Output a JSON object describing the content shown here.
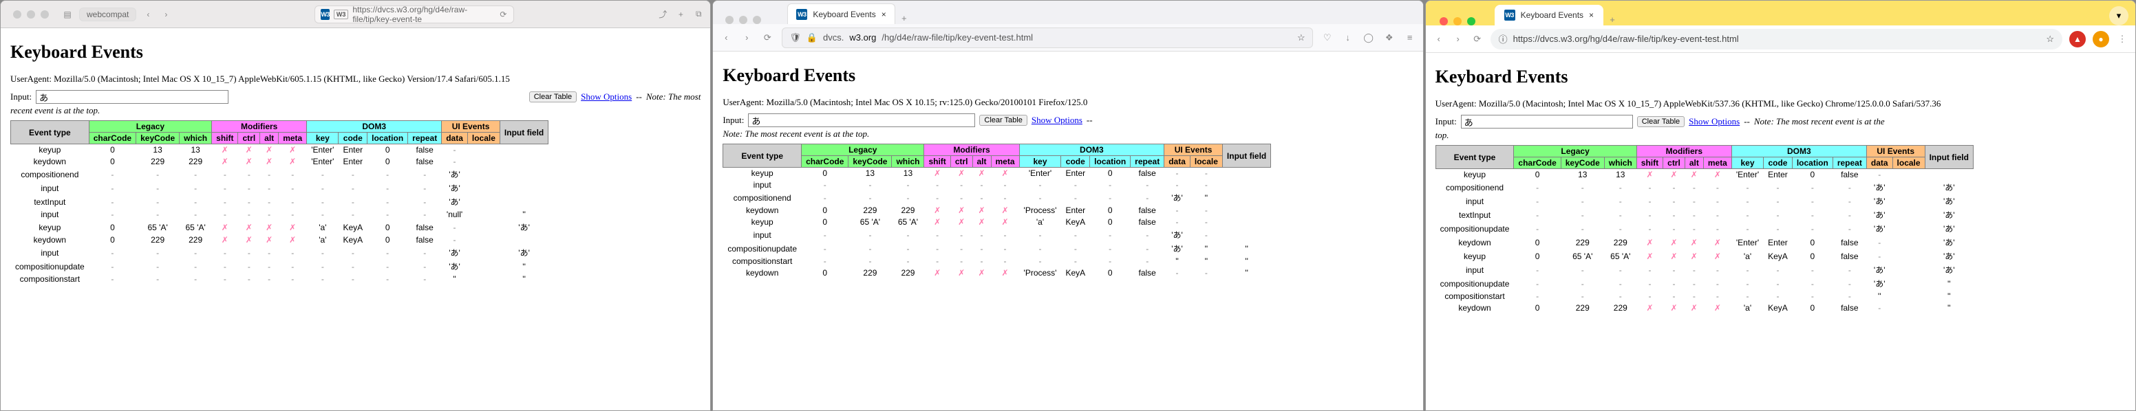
{
  "page": {
    "title": "Keyboard Events",
    "input_label": "Input:",
    "input_value": "あ",
    "clear_btn": "Clear Table",
    "show_options": "Show Options",
    "note_sep": " -- ",
    "note": "Note: The most recent event is at the top.",
    "headers": {
      "event_type": "Event type",
      "legacy": "Legacy",
      "modifiers": "Modifiers",
      "dom3": "DOM3",
      "ui": "UI Events",
      "inputf": "Input field",
      "charCode": "charCode",
      "keyCode": "keyCode",
      "which": "which",
      "shift": "shift",
      "ctrl": "ctrl",
      "alt": "alt",
      "meta": "meta",
      "key": "key",
      "code": "code",
      "location": "location",
      "repeat": "repeat",
      "data": "data",
      "locale": "locale"
    }
  },
  "label": {
    "w3": "W3",
    "close_x": "×",
    "plus": "+",
    "back": "‹",
    "fwd": "›",
    "reload": "⟳",
    "share": "⤴",
    "tabs": "⧉",
    "shield": "🛡",
    "lock": "🔒",
    "star": "☆",
    "download": "↓",
    "ext": "❖",
    "menu": "≡",
    "dots": "⋮",
    "sidebar": "▤",
    "heart": "♡"
  },
  "w1": {
    "tab_inactive": "webcompat",
    "url": "https://dvcs.w3.org/hg/d4e/raw-file/tip/key-event-te",
    "ua": "UserAgent: Mozilla/5.0 (Macintosh; Intel Mac OS X 10_15_7) AppleWebKit/605.1.15 (KHTML, like Gecko) Version/17.4 Safari/605.1.15",
    "rows": [
      {
        "t": "keyup",
        "cc": "0",
        "kc": "13",
        "wh": "13",
        "key": "'Enter'",
        "code": "Enter",
        "loc": "0",
        "rep": "false",
        "data": "-",
        "loc2": "",
        "inp": ""
      },
      {
        "t": "keydown",
        "cc": "0",
        "kc": "229",
        "wh": "229",
        "key": "'Enter'",
        "code": "Enter",
        "loc": "0",
        "rep": "false",
        "data": "-",
        "loc2": "",
        "inp": ""
      },
      {
        "t": "compositionend",
        "cc": "-",
        "kc": "-",
        "wh": "-",
        "mods": "-",
        "key": "-",
        "code": "-",
        "loc": "-",
        "rep": "-",
        "data": "'あ'",
        "loc2": "",
        "inp": ""
      },
      {
        "t": "input",
        "cc": "-",
        "kc": "-",
        "wh": "-",
        "mods": "-",
        "key": "-",
        "code": "-",
        "loc": "-",
        "rep": "-",
        "data": "'あ'",
        "loc2": "",
        "inp": ""
      },
      {
        "t": "textInput",
        "cc": "-",
        "kc": "-",
        "wh": "-",
        "mods": "-",
        "key": "-",
        "code": "-",
        "loc": "-",
        "rep": "-",
        "data": "'あ'",
        "loc2": "",
        "inp": ""
      },
      {
        "t": "input",
        "cc": "-",
        "kc": "-",
        "wh": "-",
        "mods": "-",
        "key": "-",
        "code": "-",
        "loc": "-",
        "rep": "-",
        "data": "'null'",
        "loc2": "",
        "inp": "''"
      },
      {
        "t": "keyup",
        "cc": "0",
        "kc": "65 'A'",
        "wh": "65 'A'",
        "key": "'a'",
        "code": "KeyA",
        "loc": "0",
        "rep": "false",
        "data": "-",
        "loc2": "",
        "inp": "'あ'"
      },
      {
        "t": "keydown",
        "cc": "0",
        "kc": "229",
        "wh": "229",
        "key": "'a'",
        "code": "KeyA",
        "loc": "0",
        "rep": "false",
        "data": "-",
        "loc2": "",
        "inp": ""
      },
      {
        "t": "input",
        "cc": "-",
        "kc": "-",
        "wh": "-",
        "mods": "-",
        "key": "-",
        "code": "-",
        "loc": "-",
        "rep": "-",
        "data": "'あ'",
        "loc2": "",
        "inp": "'あ'"
      },
      {
        "t": "compositionupdate",
        "cc": "-",
        "kc": "-",
        "wh": "-",
        "mods": "-",
        "key": "-",
        "code": "-",
        "loc": "-",
        "rep": "-",
        "data": "'あ'",
        "loc2": "",
        "inp": "''"
      },
      {
        "t": "compositionstart",
        "cc": "-",
        "kc": "-",
        "wh": "-",
        "mods": "-",
        "key": "-",
        "code": "-",
        "loc": "-",
        "rep": "-",
        "data": "''",
        "loc2": "",
        "inp": "''"
      }
    ]
  },
  "w2": {
    "tab_title": "Keyboard Events",
    "url_pre": "dvcs.",
    "url_dom": "w3.org",
    "url_post": "/hg/d4e/raw-file/tip/key-event-test.html",
    "ua": "UserAgent: Mozilla/5.0 (Macintosh; Intel Mac OS X 10.15; rv:125.0) Gecko/20100101 Firefox/125.0",
    "rows": [
      {
        "t": "keyup",
        "cc": "0",
        "kc": "13",
        "wh": "13",
        "key": "'Enter'",
        "code": "Enter",
        "loc": "0",
        "rep": "false",
        "data": "-",
        "loc2": "-",
        "inp": ""
      },
      {
        "t": "input",
        "cc": "-",
        "kc": "-",
        "wh": "-",
        "mods": "-",
        "key": "-",
        "code": "-",
        "loc": "-",
        "rep": "-",
        "data": "-",
        "loc2": "-",
        "inp": ""
      },
      {
        "t": "compositionend",
        "cc": "-",
        "kc": "-",
        "wh": "-",
        "mods": "-",
        "key": "-",
        "code": "-",
        "loc": "-",
        "rep": "-",
        "data": "'あ'",
        "loc2": "''",
        "inp": ""
      },
      {
        "t": "keydown",
        "cc": "0",
        "kc": "229",
        "wh": "229",
        "key": "'Process'",
        "code": "Enter",
        "loc": "0",
        "rep": "false",
        "data": "-",
        "loc2": "-",
        "inp": ""
      },
      {
        "t": "keyup",
        "cc": "0",
        "kc": "65 'A'",
        "wh": "65 'A'",
        "key": "'a'",
        "code": "KeyA",
        "loc": "0",
        "rep": "false",
        "data": "-",
        "loc2": "-",
        "inp": ""
      },
      {
        "t": "input",
        "cc": "-",
        "kc": "-",
        "wh": "-",
        "mods": "-",
        "key": "-",
        "code": "-",
        "loc": "-",
        "rep": "-",
        "data": "'あ'",
        "loc2": "-",
        "inp": ""
      },
      {
        "t": "compositionupdate",
        "cc": "-",
        "kc": "-",
        "wh": "-",
        "mods": "-",
        "key": "-",
        "code": "-",
        "loc": "-",
        "rep": "-",
        "data": "'あ'",
        "loc2": "''",
        "inp": "''"
      },
      {
        "t": "compositionstart",
        "cc": "-",
        "kc": "-",
        "wh": "-",
        "mods": "-",
        "key": "-",
        "code": "-",
        "loc": "-",
        "rep": "-",
        "data": "''",
        "loc2": "''",
        "inp": "''"
      },
      {
        "t": "keydown",
        "cc": "0",
        "kc": "229",
        "wh": "229",
        "key": "'Process'",
        "code": "KeyA",
        "loc": "0",
        "rep": "false",
        "data": "-",
        "loc2": "-",
        "inp": "''"
      }
    ]
  },
  "w3": {
    "tab_title": "Keyboard Events",
    "url": "https://dvcs.w3.org/hg/d4e/raw-file/tip/key-event-test.html",
    "ua": "UserAgent: Mozilla/5.0 (Macintosh; Intel Mac OS X 10_15_7) AppleWebKit/537.36 (KHTML, like Gecko) Chrome/125.0.0.0 Safari/537.36",
    "rows": [
      {
        "t": "keyup",
        "cc": "0",
        "kc": "13",
        "wh": "13",
        "key": "'Enter'",
        "code": "Enter",
        "loc": "0",
        "rep": "false",
        "data": "-",
        "loc2": "",
        "inp": ""
      },
      {
        "t": "compositionend",
        "cc": "-",
        "kc": "-",
        "wh": "-",
        "mods": "-",
        "key": "-",
        "code": "-",
        "loc": "-",
        "rep": "-",
        "data": "'あ'",
        "loc2": "",
        "inp": "'あ'"
      },
      {
        "t": "input",
        "cc": "-",
        "kc": "-",
        "wh": "-",
        "mods": "-",
        "key": "-",
        "code": "-",
        "loc": "-",
        "rep": "-",
        "data": "'あ'",
        "loc2": "",
        "inp": "'あ'"
      },
      {
        "t": "textInput",
        "cc": "-",
        "kc": "-",
        "wh": "-",
        "mods": "-",
        "key": "-",
        "code": "-",
        "loc": "-",
        "rep": "-",
        "data": "'あ'",
        "loc2": "",
        "inp": "'あ'"
      },
      {
        "t": "compositionupdate",
        "cc": "-",
        "kc": "-",
        "wh": "-",
        "mods": "-",
        "key": "-",
        "code": "-",
        "loc": "-",
        "rep": "-",
        "data": "'あ'",
        "loc2": "",
        "inp": "'あ'"
      },
      {
        "t": "keydown",
        "cc": "0",
        "kc": "229",
        "wh": "229",
        "key": "'Enter'",
        "code": "Enter",
        "loc": "0",
        "rep": "false",
        "data": "-",
        "loc2": "",
        "inp": "'あ'"
      },
      {
        "t": "keyup",
        "cc": "0",
        "kc": "65 'A'",
        "wh": "65 'A'",
        "key": "'a'",
        "code": "KeyA",
        "loc": "0",
        "rep": "false",
        "data": "-",
        "loc2": "",
        "inp": "'あ'"
      },
      {
        "t": "input",
        "cc": "-",
        "kc": "-",
        "wh": "-",
        "mods": "-",
        "key": "-",
        "code": "-",
        "loc": "-",
        "rep": "-",
        "data": "'あ'",
        "loc2": "",
        "inp": "'あ'"
      },
      {
        "t": "compositionupdate",
        "cc": "-",
        "kc": "-",
        "wh": "-",
        "mods": "-",
        "key": "-",
        "code": "-",
        "loc": "-",
        "rep": "-",
        "data": "'あ'",
        "loc2": "",
        "inp": "''"
      },
      {
        "t": "compositionstart",
        "cc": "-",
        "kc": "-",
        "wh": "-",
        "mods": "-",
        "key": "-",
        "code": "-",
        "loc": "-",
        "rep": "-",
        "data": "''",
        "loc2": "",
        "inp": "''"
      },
      {
        "t": "keydown",
        "cc": "0",
        "kc": "229",
        "wh": "229",
        "key": "'a'",
        "code": "KeyA",
        "loc": "0",
        "rep": "false",
        "data": "-",
        "loc2": "",
        "inp": "''"
      }
    ]
  }
}
